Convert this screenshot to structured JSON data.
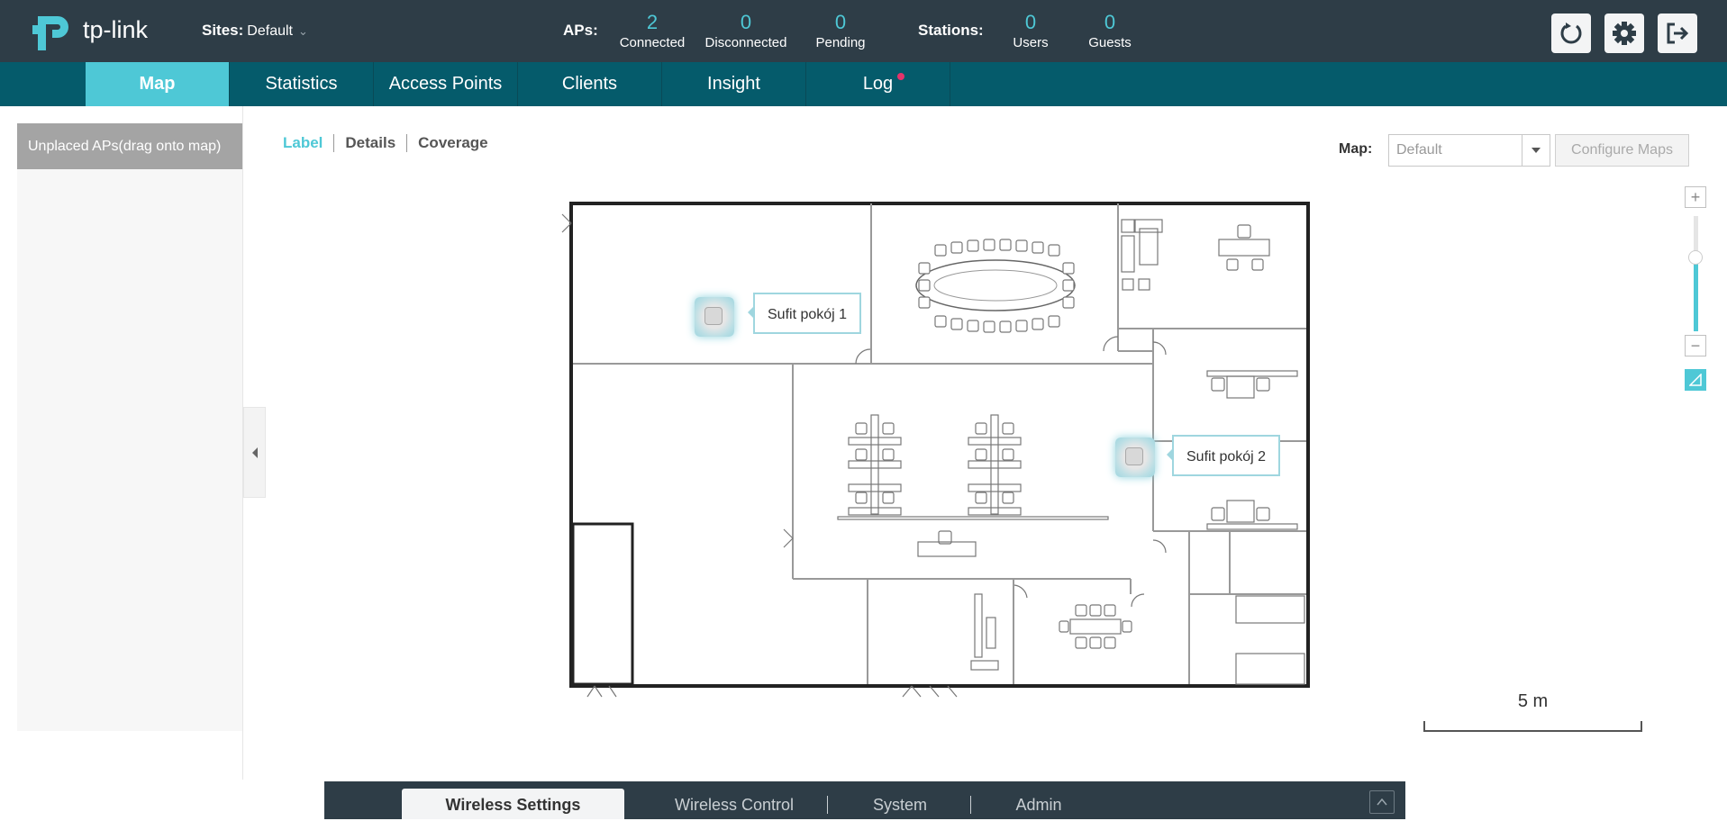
{
  "brand": {
    "logo_text": "tp-link"
  },
  "header": {
    "sites_label": "Sites:",
    "site_value": "Default",
    "aps_label": "APs:",
    "aps": [
      {
        "value": "2",
        "caption": "Connected"
      },
      {
        "value": "0",
        "caption": "Disconnected"
      },
      {
        "value": "0",
        "caption": "Pending"
      }
    ],
    "stations_label": "Stations:",
    "stations": [
      {
        "value": "0",
        "caption": "Users"
      },
      {
        "value": "0",
        "caption": "Guests"
      }
    ],
    "icons": [
      "refresh-icon",
      "gear-icon",
      "logout-icon"
    ]
  },
  "nav": {
    "tabs": [
      "Map",
      "Statistics",
      "Access Points",
      "Clients",
      "Insight",
      "Log"
    ],
    "active": "Map"
  },
  "left_panel": {
    "title": "Unplaced APs(drag onto map)"
  },
  "subtabs": [
    "Label",
    "Details",
    "Coverage"
  ],
  "map_controls": {
    "map_label": "Map:",
    "map_value": "Default",
    "configure_label": "Configure Maps"
  },
  "zoom": {
    "level": 0.64
  },
  "aps_on_map": [
    {
      "label": "Sufit pokój 1"
    },
    {
      "label": "Sufit pokój 2"
    }
  ],
  "scale": {
    "label": "5 m"
  },
  "bottom": {
    "tabs": [
      "Wireless Settings",
      "Wireless Control",
      "System",
      "Admin"
    ],
    "active": "Wireless Settings"
  },
  "colors": {
    "accent": "#4ec8d6",
    "topbar": "#2e3d47",
    "navbar": "#055b6b",
    "notify_dot": "#e5336b"
  }
}
